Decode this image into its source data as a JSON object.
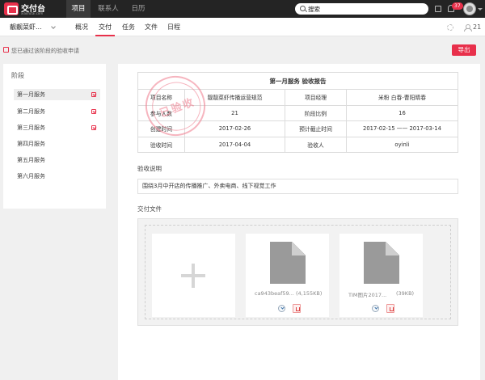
{
  "app": {
    "logo_title": "交付台",
    "logo_sub": "xiaofutai.com"
  },
  "topnav": {
    "items": [
      "项目",
      "联系人",
      "日历"
    ],
    "active": 0
  },
  "search": {
    "label": "搜索"
  },
  "notifications": {
    "count": "37"
  },
  "subnav": {
    "project_name": "靓靓菜虾...",
    "tabs": [
      "概况",
      "交付",
      "任务",
      "文件",
      "日程"
    ],
    "active": 1,
    "member_count": "21"
  },
  "notice": {
    "text": "您已通过该阶段的验收申请",
    "export_label": "导出"
  },
  "stages": {
    "title": "阶段",
    "items": [
      {
        "label": "第一月服务",
        "checked": true
      },
      {
        "label": "第二月服务",
        "checked": true
      },
      {
        "label": "第三月服务",
        "checked": true
      },
      {
        "label": "第四月服务",
        "checked": false
      },
      {
        "label": "第五月服务",
        "checked": false
      },
      {
        "label": "第六月服务",
        "checked": false
      }
    ],
    "active": 0
  },
  "report": {
    "title": "第一月服务  验收报告",
    "rows": [
      [
        "项目名称",
        "靓靓菜虾传播运营规范",
        "项目经理",
        "米粉  白春-曹阳晴春"
      ],
      [
        "参与人数",
        "21",
        "阶段比例",
        "16"
      ],
      [
        "创建时间",
        "2017-02-26",
        "预计截止时间",
        "2017-02-15 —— 2017-03-14"
      ],
      [
        "验收时间",
        "2017-04-04",
        "验收人",
        "oyinli"
      ]
    ],
    "stamp_text": "已验收"
  },
  "description": {
    "label": "验收说明",
    "text": "围绕3月中开店的传播推广、外卖电商、线下视觉工作"
  },
  "files": {
    "label": "交付文件",
    "items": [
      {
        "name": "ca943beaf59...",
        "size": "(4,155KB)"
      },
      {
        "name": "TIM图片2017...",
        "size": "(39KB)"
      }
    ]
  },
  "colors": {
    "accent": "#e8304b",
    "topbar": "#242424"
  }
}
